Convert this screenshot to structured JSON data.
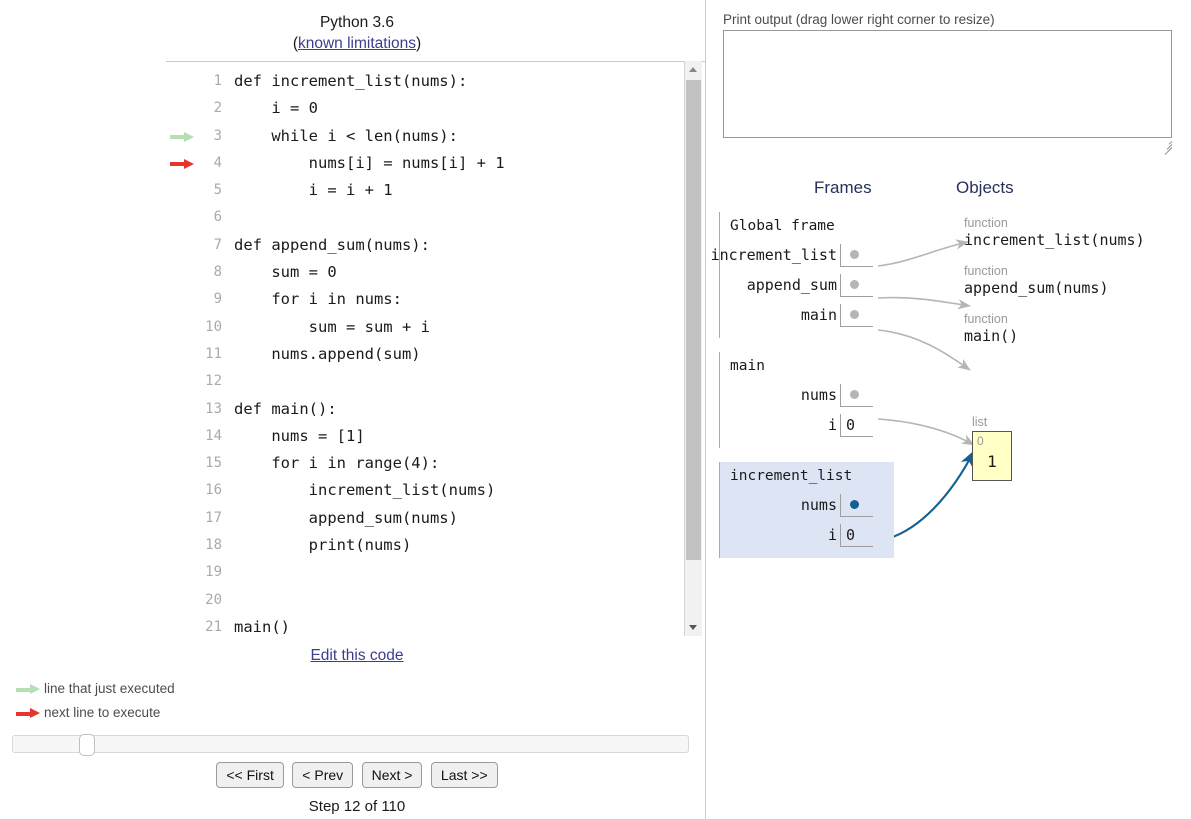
{
  "code_panel": {
    "python_version": "Python 3.6",
    "limitations_open_paren": "(",
    "limitations_link": "known limitations",
    "limitations_close_paren": ")",
    "edit_link": "Edit this code",
    "lines": [
      {
        "num": "1",
        "text": "def increment_list(nums):",
        "arrow": "none"
      },
      {
        "num": "2",
        "text": "    i = 0",
        "arrow": "none"
      },
      {
        "num": "3",
        "text": "    while i < len(nums):",
        "arrow": "green"
      },
      {
        "num": "4",
        "text": "        nums[i] = nums[i] + 1",
        "arrow": "red"
      },
      {
        "num": "5",
        "text": "        i = i + 1",
        "arrow": "none"
      },
      {
        "num": "6",
        "text": "",
        "arrow": "none"
      },
      {
        "num": "7",
        "text": "def append_sum(nums):",
        "arrow": "none"
      },
      {
        "num": "8",
        "text": "    sum = 0",
        "arrow": "none"
      },
      {
        "num": "9",
        "text": "    for i in nums:",
        "arrow": "none"
      },
      {
        "num": "10",
        "text": "        sum = sum + i",
        "arrow": "none"
      },
      {
        "num": "11",
        "text": "    nums.append(sum)",
        "arrow": "none"
      },
      {
        "num": "12",
        "text": "",
        "arrow": "none"
      },
      {
        "num": "13",
        "text": "def main():",
        "arrow": "none"
      },
      {
        "num": "14",
        "text": "    nums = [1]",
        "arrow": "none"
      },
      {
        "num": "15",
        "text": "    for i in range(4):",
        "arrow": "none"
      },
      {
        "num": "16",
        "text": "        increment_list(nums)",
        "arrow": "none"
      },
      {
        "num": "17",
        "text": "        append_sum(nums)",
        "arrow": "none"
      },
      {
        "num": "18",
        "text": "        print(nums)",
        "arrow": "none"
      },
      {
        "num": "19",
        "text": "",
        "arrow": "none"
      },
      {
        "num": "20",
        "text": "",
        "arrow": "none"
      },
      {
        "num": "21",
        "text": "main()",
        "arrow": "none"
      }
    ]
  },
  "legend": {
    "just_executed": "line that just executed",
    "next_line": "next line to execute",
    "green_color": "#b4e0b4",
    "red_color": "#e8352b"
  },
  "controls": {
    "first": "<< First",
    "prev": "< Prev",
    "next": "Next >",
    "last": "Last >>",
    "step_counter": "Step 12 of 110",
    "slider_position_percent": 10
  },
  "print_output": {
    "label": "Print output (drag lower right corner to resize)",
    "value": "",
    "placeholder": ""
  },
  "visualization": {
    "frames_header": "Frames",
    "objects_header": "Objects",
    "frames": [
      {
        "title": "Global frame",
        "active": false,
        "vars": [
          {
            "name": "increment_list",
            "kind": "pointer",
            "dot": "gray"
          },
          {
            "name": "append_sum",
            "kind": "pointer",
            "dot": "gray"
          },
          {
            "name": "main",
            "kind": "pointer",
            "dot": "gray"
          }
        ]
      },
      {
        "title": "main",
        "active": false,
        "vars": [
          {
            "name": "nums",
            "kind": "pointer",
            "dot": "gray"
          },
          {
            "name": "i",
            "kind": "value",
            "value": "0"
          }
        ]
      },
      {
        "title": "increment_list",
        "active": true,
        "vars": [
          {
            "name": "nums",
            "kind": "pointer",
            "dot": "blue"
          },
          {
            "name": "i",
            "kind": "value",
            "value": "0"
          }
        ]
      }
    ],
    "objects": [
      {
        "type": "function",
        "label": "increment_list(nums)"
      },
      {
        "type": "function",
        "label": "append_sum(nums)"
      },
      {
        "type": "function",
        "label": "main()"
      }
    ],
    "list_object": {
      "type": "list",
      "indices": [
        "0"
      ],
      "values": [
        "1"
      ],
      "fill_color": "#ffffc6"
    },
    "pointer_colors": {
      "inactive": "#b5b5b5",
      "active": "#14608f"
    }
  }
}
